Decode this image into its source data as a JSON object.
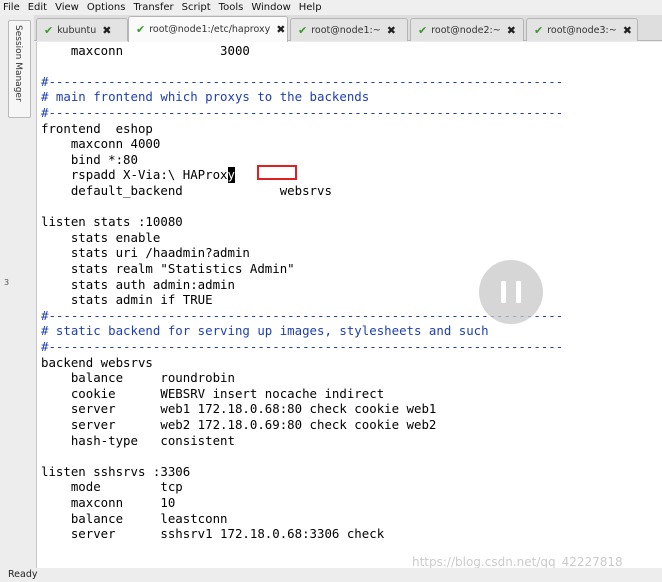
{
  "menu": [
    "File",
    "Edit",
    "View",
    "Options",
    "Transfer",
    "Script",
    "Tools",
    "Window",
    "Help"
  ],
  "session_manager_label": "Session Manager",
  "tabs": [
    {
      "label": "kubuntu",
      "active": false
    },
    {
      "label": "root@node1:/etc/haproxy",
      "active": true
    },
    {
      "label": "root@node1:~",
      "active": false
    },
    {
      "label": "root@node2:~",
      "active": false
    },
    {
      "label": "root@node3:~",
      "active": false
    }
  ],
  "terminal": {
    "lines": [
      {
        "text": "    maxconn             3000",
        "type": "normal"
      },
      {
        "text": "",
        "type": "normal"
      },
      {
        "text": "#---------------------------------------------------------------------",
        "type": "comment"
      },
      {
        "text": "# main frontend which proxys to the backends",
        "type": "comment"
      },
      {
        "text": "#---------------------------------------------------------------------",
        "type": "comment"
      },
      {
        "text": "frontend  eshop",
        "type": "normal"
      },
      {
        "text": "    maxconn 4000",
        "type": "normal"
      },
      {
        "text": "    bind *:80",
        "type": "normal"
      },
      {
        "text": "    rspadd X-Via:\\ HAProx",
        "type": "cursor",
        "cursor_char": "y"
      },
      {
        "text": "    default_backend             websrvs",
        "type": "normal"
      },
      {
        "text": "",
        "type": "normal"
      },
      {
        "text": "listen stats :10080",
        "type": "normal"
      },
      {
        "text": "    stats enable",
        "type": "normal"
      },
      {
        "text": "    stats uri /haadmin?admin",
        "type": "normal"
      },
      {
        "text": "    stats realm \"Statistics Admin\"",
        "type": "normal"
      },
      {
        "text": "    stats auth admin:admin",
        "type": "normal"
      },
      {
        "text": "    stats admin if TRUE",
        "type": "normal"
      },
      {
        "text": "#---------------------------------------------------------------------",
        "type": "comment"
      },
      {
        "text": "# static backend for serving up images, stylesheets and such",
        "type": "comment"
      },
      {
        "text": "#---------------------------------------------------------------------",
        "type": "comment"
      },
      {
        "text": "backend websrvs",
        "type": "normal"
      },
      {
        "text": "    balance     roundrobin",
        "type": "normal"
      },
      {
        "text": "    cookie      WEBSRV insert nocache indirect",
        "type": "normal"
      },
      {
        "text": "    server      web1 172.18.0.68:80 check cookie web1",
        "type": "normal"
      },
      {
        "text": "    server      web2 172.18.0.69:80 check cookie web2",
        "type": "normal"
      },
      {
        "text": "    hash-type   consistent",
        "type": "normal"
      },
      {
        "text": "",
        "type": "normal"
      },
      {
        "text": "listen sshsrvs :3306",
        "type": "normal"
      },
      {
        "text": "    mode        tcp",
        "type": "normal"
      },
      {
        "text": "    maxconn     10",
        "type": "normal"
      },
      {
        "text": "    balance     leastconn",
        "type": "normal"
      },
      {
        "text": "    server      sshsrv1 172.18.0.68:3306 check",
        "type": "normal"
      }
    ]
  },
  "watermark": "https://blog.csdn.net/qq_42227818",
  "status": "Ready",
  "left_marker": "3",
  "colors": {
    "comment": "#1e3fb3",
    "highlight_box": "#e02020",
    "check": "#3a9a2a"
  }
}
